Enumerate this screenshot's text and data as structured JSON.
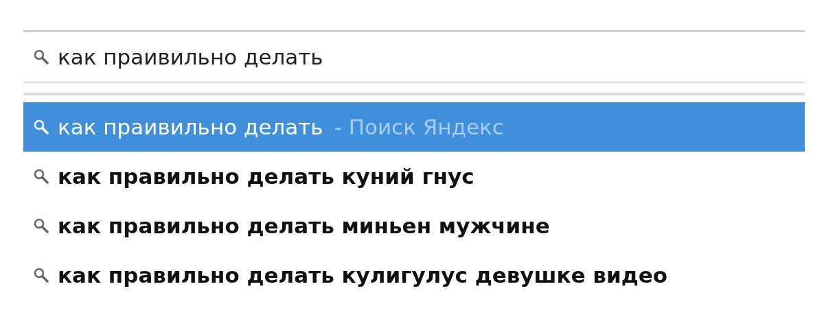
{
  "search": {
    "value": "как праивильно делать"
  },
  "suggestions": [
    {
      "kind": "search",
      "text": "как праивильно делать",
      "hint": "- Поиск Яндекс",
      "selected": true
    },
    {
      "kind": "suggestion",
      "text": "как правильно делать куний гнус",
      "selected": false
    },
    {
      "kind": "suggestion",
      "text": "как правильно делать миньен мужчине",
      "selected": false
    },
    {
      "kind": "suggestion",
      "text": "как правильно делать кулигулус девушке видео",
      "selected": false
    }
  ]
}
